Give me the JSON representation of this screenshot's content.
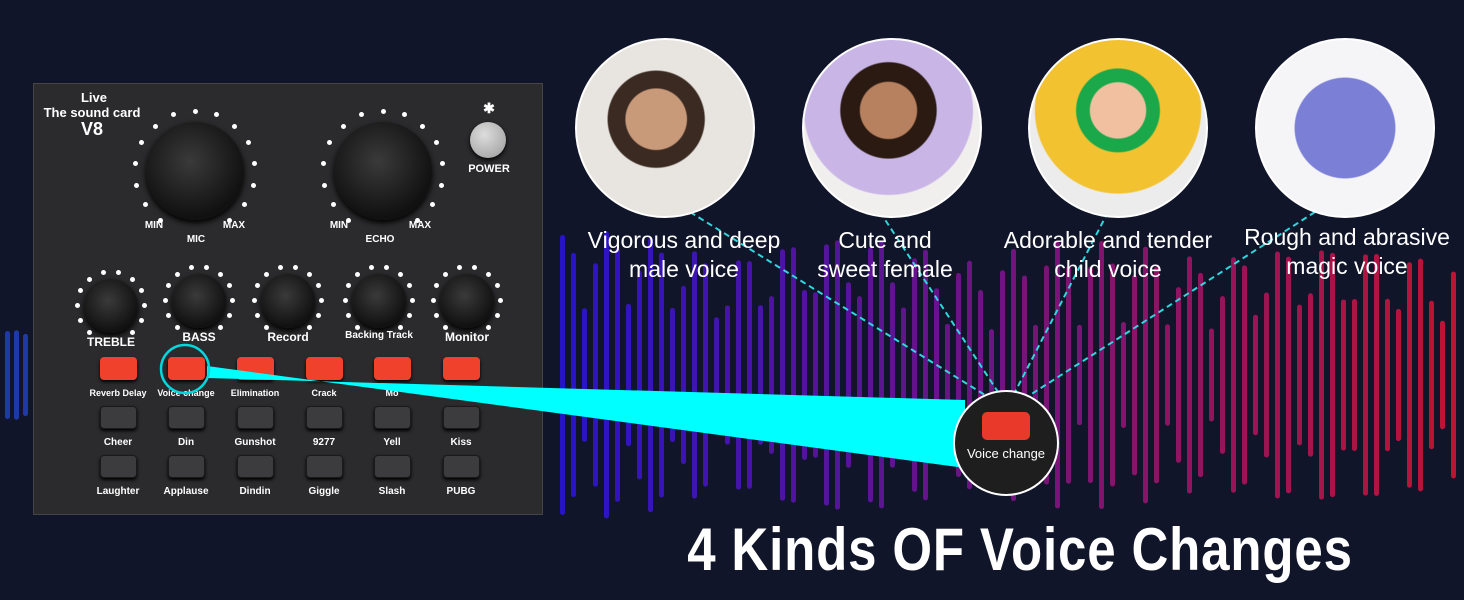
{
  "device": {
    "brand_line1": "Live",
    "brand_line2": "The sound card",
    "model": "V8",
    "bluetooth_icon": "bluetooth-icon",
    "power_label": "POWER",
    "mic": {
      "label": "MIC",
      "min": "MIN",
      "max": "MAX"
    },
    "echo": {
      "label": "ECHO",
      "min": "MIN",
      "max": "MAX"
    },
    "small_knobs": [
      "TREBLE",
      "BASS",
      "Record",
      "Backing Track",
      "Monitor"
    ],
    "row1_labels": [
      "Reverb Delay",
      "Voice change",
      "Elimination",
      "Crack",
      "Mo",
      ""
    ],
    "row2_labels": [
      "Cheer",
      "Din",
      "Gunshot",
      "9277",
      "Yell",
      "Kiss"
    ],
    "row3_labels": [
      "Laughter",
      "Applause",
      "Dindin",
      "Giggle",
      "Slash",
      "PUBG"
    ]
  },
  "voices": [
    {
      "line1": "Vigorous and deep",
      "line2": "male voice"
    },
    {
      "line1": "Cute and",
      "line2": "sweet female"
    },
    {
      "line1": "Adorable and tender",
      "line2": "child voice"
    },
    {
      "line1": "Rough and abrasive",
      "line2": "magic voice"
    }
  ],
  "zoom_label": "Voice change",
  "title": "4 Kinds OF Voice Changes",
  "colors": {
    "background": "#10152a",
    "highlight": "#00ffff",
    "red_button": "#f0412c"
  }
}
